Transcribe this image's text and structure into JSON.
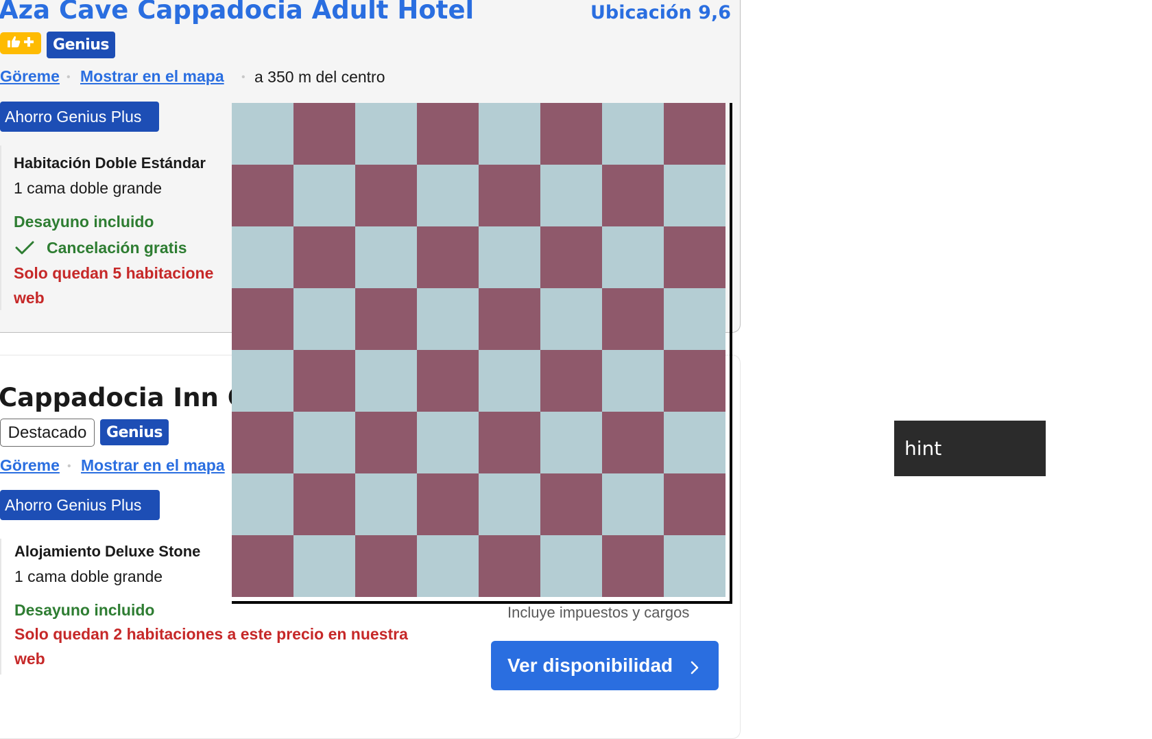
{
  "listing1": {
    "title": "Aza Cave Cappadocia Adult Hotel",
    "score_label": "Ubicación 9,6",
    "genius_label": "Genius",
    "location_link": "Göreme",
    "map_link": "Mostrar en el mapa",
    "distance": "a 350 m del centro",
    "deal_badge": "Ahorro Genius Plus",
    "room_name": "Habitación Doble Estándar",
    "bed": "1 cama doble grande",
    "breakfast": "Desayuno incluido",
    "cancellation": "Cancelación gratis",
    "scarcity": "Solo quedan 5 habitacione",
    "scarcity_line2": "web"
  },
  "listing2": {
    "title": "Cappadocia Inn C",
    "featured_tag": "Destacado",
    "genius_label": "Genius",
    "location_link": "Göreme",
    "map_link": "Mostrar en el mapa",
    "deal_badge": "Ahorro Genius Plus",
    "room_name": "Alojamiento Deluxe Stone",
    "bed": "1 cama doble grande",
    "breakfast": "Desayuno incluido",
    "scarcity": "Solo quedan 2 habitaciones a este precio en nuestra",
    "scarcity_line2": "web",
    "taxes_note": "Incluye impuestos y cargos",
    "cta": "Ver disponibilidad"
  },
  "board": {
    "rows": 8,
    "cols": 8,
    "light_color": "#b4cdd3",
    "dark_color": "#8f596b"
  },
  "hint": {
    "label": "hint"
  },
  "colors": {
    "link_blue": "#2a6ee0",
    "genius_blue": "#1d4eb5",
    "success_green": "#2e7d32",
    "urgency_red": "#c62828",
    "thumbs_yellow": "#febb02"
  }
}
